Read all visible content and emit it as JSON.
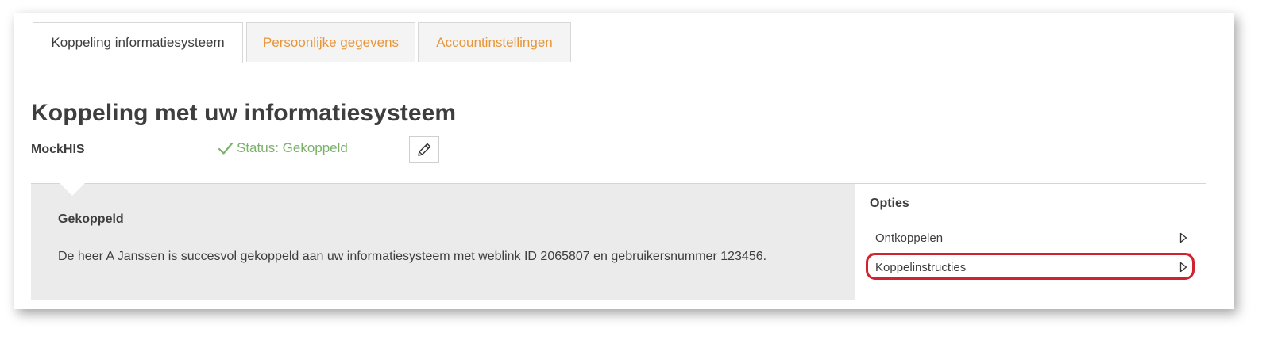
{
  "tabs": [
    {
      "label": "Koppeling informatiesysteem",
      "active": true
    },
    {
      "label": "Persoonlijke gegevens",
      "active": false
    },
    {
      "label": "Accountinstellingen",
      "active": false
    }
  ],
  "page": {
    "title": "Koppeling met uw informatiesysteem",
    "system_name": "MockHIS",
    "status_text": "Status: Gekoppeld"
  },
  "panel": {
    "heading": "Gekoppeld",
    "text": "De heer A Janssen is succesvol gekoppeld aan uw informatiesysteem met weblink ID 2065807 en gebruikersnummer 123456."
  },
  "options": {
    "title": "Opties",
    "items": [
      {
        "label": "Ontkoppelen"
      },
      {
        "label": "Koppelinstructies",
        "highlighted": true
      }
    ]
  },
  "colors": {
    "accent_orange": "#e8963a",
    "status_green": "#7ab26a",
    "highlight_red": "#d0222f"
  },
  "icons": {
    "status": "checkmark-icon",
    "edit": "pencil-icon",
    "option_arrow": "triangle-right-icon"
  }
}
